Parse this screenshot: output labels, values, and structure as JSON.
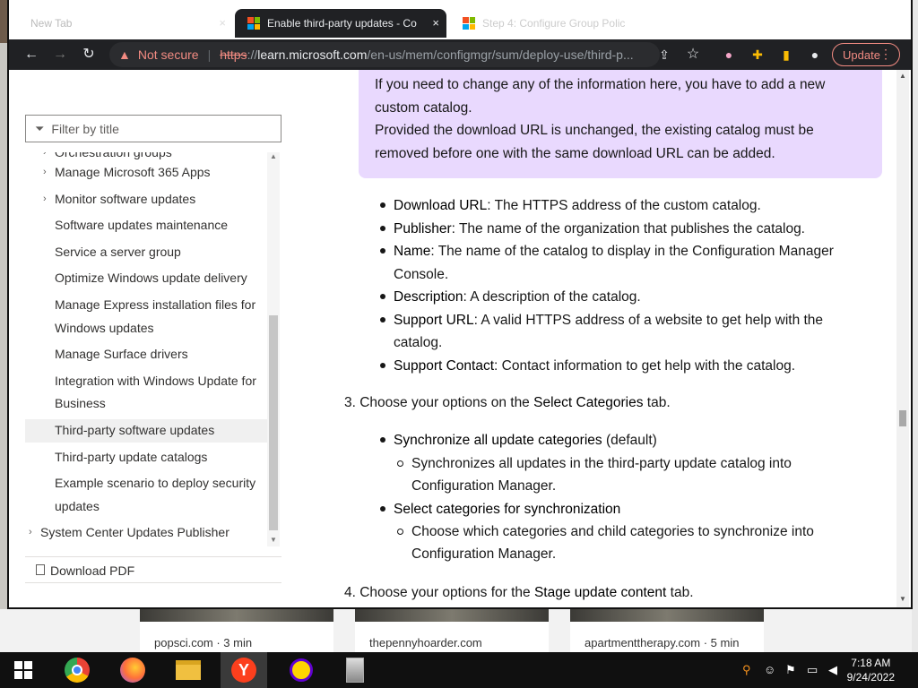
{
  "browser": {
    "tabs": [
      {
        "label": "New Tab",
        "active": false
      },
      {
        "label": "Enable third-party updates - Co",
        "active": true
      },
      {
        "label": "Step 4: Configure Group Polic",
        "active": false
      }
    ],
    "close_glyph": "×",
    "security_label": "Not secure",
    "url_scheme": "https",
    "url_sep": "://",
    "url_host": "learn.microsoft.com",
    "url_path": "/en-us/mem/configmgr/sum/deploy-use/third-p...",
    "update_label": "Update"
  },
  "sidebar": {
    "filter_placeholder": "Filter by title",
    "items": [
      {
        "label": "Orchestration groups",
        "chevron": true
      },
      {
        "label": "Manage Microsoft 365 Apps",
        "chevron": true
      },
      {
        "label": "Monitor software updates",
        "chevron": true
      },
      {
        "label": "Software updates maintenance",
        "chevron": false
      },
      {
        "label": "Service a server group",
        "chevron": false
      },
      {
        "label": "Optimize Windows update delivery",
        "chevron": false
      },
      {
        "label": "Manage Express installation files for",
        "chevron": false
      },
      {
        "label": "Windows updates",
        "chevron": false
      },
      {
        "label": "Manage Surface drivers",
        "chevron": false
      },
      {
        "label": "Integration with Windows Update for",
        "chevron": false
      },
      {
        "label": "Business",
        "chevron": false
      },
      {
        "label": "Third-party software updates",
        "chevron": false,
        "selected": true
      },
      {
        "label": "Third-party update catalogs",
        "chevron": false
      },
      {
        "label": "Example scenario to deploy security",
        "chevron": false
      },
      {
        "label": "updates",
        "chevron": false
      },
      {
        "label": "System Center Updates Publisher",
        "chevron": true,
        "top_level": true
      }
    ],
    "download_pdf": "Download PDF"
  },
  "article": {
    "note": [
      "If you need to change any of the information here, you have to add a new",
      "custom catalog.",
      "Provided the download URL is unchanged, the existing catalog must be",
      "removed before one with the same download URL can be added."
    ],
    "fields": [
      {
        "term": "Download URL",
        "lines": [
          ": The HTTPS address of the custom catalog."
        ]
      },
      {
        "term": "Publisher",
        "lines": [
          ": The name of the organization that publishes the catalog."
        ]
      },
      {
        "term": "Name",
        "lines": [
          ": The name of the catalog to display in the Configuration Manager",
          "Console."
        ]
      },
      {
        "term": "Description",
        "lines": [
          ": A description of the catalog."
        ]
      },
      {
        "term": "Support URL",
        "lines": [
          ": A valid HTTPS address of a website to get help with the",
          "catalog."
        ]
      },
      {
        "term": "Support Contact",
        "lines": [
          ": Contact information to get help with the catalog."
        ]
      }
    ],
    "step3": {
      "prefix": "3. Choose your options on the ",
      "bold": "Select Categories",
      "suffix": " tab."
    },
    "opt1": {
      "term": "Synchronize all update categories",
      "suffix": " (default)",
      "sub": [
        "Synchronizes all updates in the third-party update catalog into",
        "Configuration Manager."
      ]
    },
    "opt2": {
      "term": "Select categories for synchronization",
      "sub": [
        "Choose which categories and child categories to synchronize into",
        "Configuration Manager."
      ]
    },
    "step4": {
      "prefix": "4. Choose your options for the ",
      "bold": "Stage update content",
      "suffix": " tab."
    }
  },
  "background_cards": [
    {
      "source": "popsci.com · 3 min"
    },
    {
      "source": "thepennyhoarder.com"
    },
    {
      "source": "apartmenttherapy.com · 5 min"
    }
  ],
  "taskbar": {
    "time": "7:18 AM",
    "date": "9/24/2022",
    "apps": [
      "start-icon",
      "chrome-icon",
      "firefox-icon",
      "file-explorer-icon",
      "yandex-icon",
      "yahoo-messenger-icon",
      "app-icon"
    ]
  },
  "colors": {
    "accent_red": "#f28b82",
    "note_bg": "#e9d9fe",
    "chrome_dark": "#202124"
  }
}
